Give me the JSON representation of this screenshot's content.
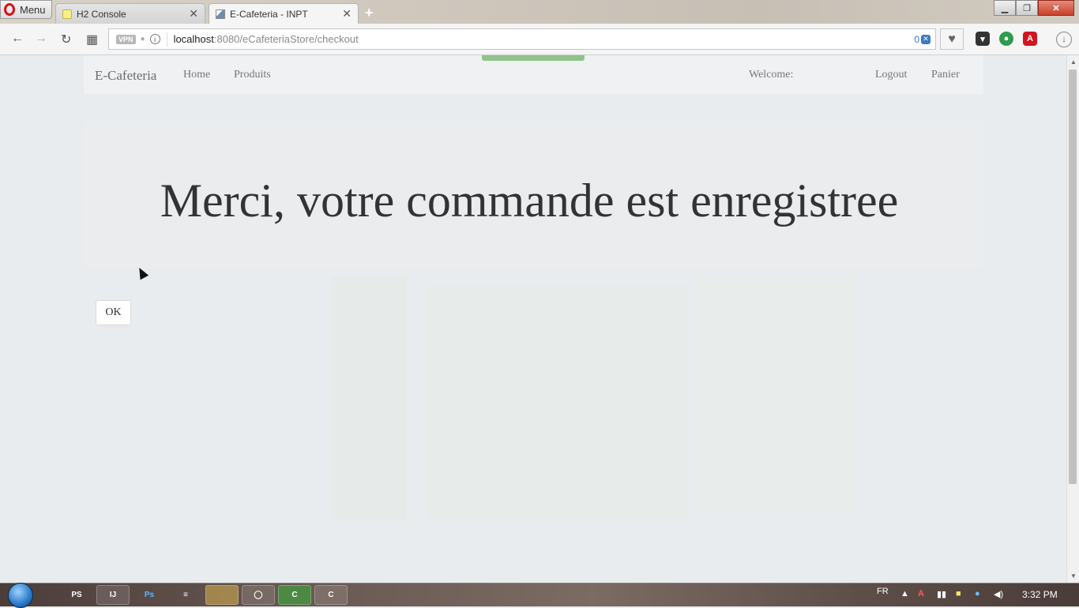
{
  "browser": {
    "menu_label": "Menu",
    "tabs": [
      {
        "title": "H2 Console",
        "close": "✕"
      },
      {
        "title": "E-Cafeteria - INPT",
        "close": "✕"
      }
    ],
    "new_tab": "+",
    "window_controls": {
      "minimize": "▁",
      "restore": "❐",
      "close": "✕"
    },
    "nav": {
      "back": "←",
      "forward": "→",
      "reload": "↻",
      "speed_dial": "▦"
    },
    "address": {
      "vpn": "VPN",
      "host": "localhost",
      "path": ":8080/eCafeteriaStore/checkout",
      "adblock_count": "0"
    },
    "heart": "♥"
  },
  "page": {
    "navbar": {
      "brand": "E-Cafeteria",
      "home": "Home",
      "products": "Produits",
      "welcome": "Welcome:",
      "logout": "Logout",
      "cart": "Panier"
    },
    "headline": "Merci, votre commande est enregistree",
    "ok_button": "OK"
  },
  "taskbar": {
    "apps": [
      "PS",
      "IJ",
      "Ps",
      "≡",
      "",
      "◯",
      "C",
      "C"
    ],
    "language": "FR",
    "time": "3:32 PM"
  },
  "colors": {
    "page_bg": "#e9ecee",
    "headline": "#333333",
    "accent_green": "#8ec48a",
    "opera_red": "#d2141e"
  }
}
